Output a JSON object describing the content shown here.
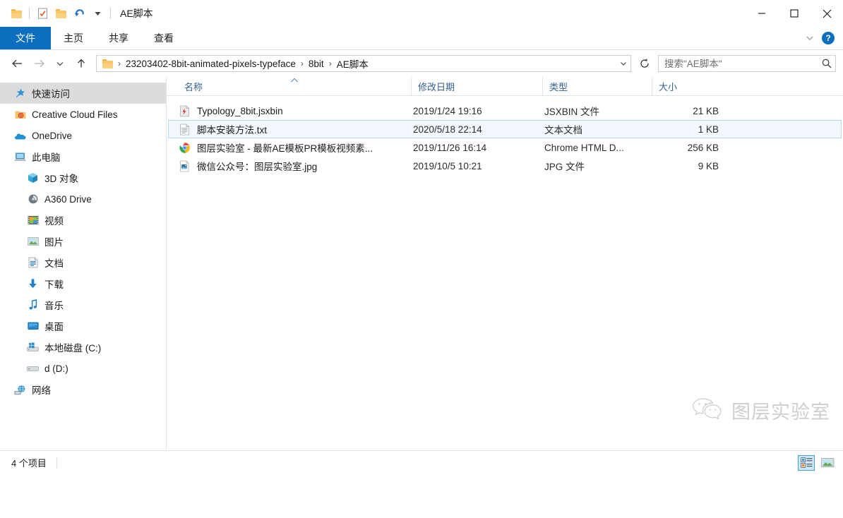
{
  "window": {
    "title": "AE脚本",
    "quick_access": [
      {
        "name": "folder-icon",
        "label": "folder"
      },
      {
        "name": "properties-icon",
        "label": "属性"
      },
      {
        "name": "new-folder-icon",
        "label": "新建文件夹"
      },
      {
        "name": "undo-icon",
        "label": "撤消"
      },
      {
        "name": "customize-qat-icon",
        "label": "自定义快速访问工具栏"
      }
    ],
    "controls": {
      "minimize": "—",
      "maximize": "□",
      "close": "✕"
    }
  },
  "ribbon": {
    "tabs": [
      {
        "label": "文件",
        "active": true
      },
      {
        "label": "主页",
        "active": false
      },
      {
        "label": "共享",
        "active": false
      },
      {
        "label": "查看",
        "active": false
      }
    ],
    "expand_icon": "chevron-down-icon",
    "help_label": "?"
  },
  "address": {
    "back_icon": "arrow-left-icon",
    "forward_icon": "arrow-right-icon",
    "recent_icon": "chevron-down-icon",
    "up_icon": "arrow-up-icon",
    "folder_icon": "folder-icon",
    "crumbs": [
      "23203402-8bit-animated-pixels-typeface",
      "8bit",
      "AE脚本"
    ],
    "separator": "›",
    "dropdown_icon": "chevron-down-icon",
    "refresh_icon": "refresh-icon"
  },
  "search": {
    "placeholder": "搜索\"AE脚本\"",
    "value": "",
    "icon": "search-icon"
  },
  "sidebar": {
    "items": [
      {
        "label": "快速访问",
        "icon": "pin-star-icon",
        "selected": true,
        "indent": false
      },
      {
        "label": "Creative Cloud Files",
        "icon": "creative-cloud-folder-icon",
        "selected": false,
        "indent": false
      },
      {
        "label": "OneDrive",
        "icon": "onedrive-cloud-icon",
        "selected": false,
        "indent": false
      },
      {
        "label": "此电脑",
        "icon": "this-pc-icon",
        "selected": false,
        "indent": false
      },
      {
        "label": "3D 对象",
        "icon": "3d-objects-icon",
        "selected": false,
        "indent": true
      },
      {
        "label": "A360 Drive",
        "icon": "a360-drive-icon",
        "selected": false,
        "indent": true
      },
      {
        "label": "视频",
        "icon": "videos-icon",
        "selected": false,
        "indent": true
      },
      {
        "label": "图片",
        "icon": "pictures-icon",
        "selected": false,
        "indent": true
      },
      {
        "label": "文档",
        "icon": "documents-icon",
        "selected": false,
        "indent": true
      },
      {
        "label": "下载",
        "icon": "downloads-icon",
        "selected": false,
        "indent": true
      },
      {
        "label": "音乐",
        "icon": "music-icon",
        "selected": false,
        "indent": true
      },
      {
        "label": "桌面",
        "icon": "desktop-icon",
        "selected": false,
        "indent": true
      },
      {
        "label": "本地磁盘 (C:)",
        "icon": "windows-drive-icon",
        "selected": false,
        "indent": true
      },
      {
        "label": "d (D:)",
        "icon": "drive-icon",
        "selected": false,
        "indent": true
      },
      {
        "label": "网络",
        "icon": "network-icon",
        "selected": false,
        "indent": false
      }
    ]
  },
  "filelist": {
    "columns": [
      {
        "label": "名称",
        "sorted": "asc"
      },
      {
        "label": "修改日期",
        "sorted": ""
      },
      {
        "label": "类型",
        "sorted": ""
      },
      {
        "label": "大小",
        "sorted": ""
      }
    ],
    "sort_caret": "︿",
    "rows": [
      {
        "name": "Typology_8bit.jsxbin",
        "date": "2019/1/24 19:16",
        "type": "JSXBIN 文件",
        "size": "21 KB",
        "icon": "jsxbin-file-icon",
        "selected": false
      },
      {
        "name": "脚本安装方法.txt",
        "date": "2020/5/18 22:14",
        "type": "文本文档",
        "size": "1 KB",
        "icon": "text-file-icon",
        "selected": true
      },
      {
        "name": "图层实验室 - 最新AE模板PR模板视频素...",
        "date": "2019/11/26 16:14",
        "type": "Chrome HTML D...",
        "size": "256 KB",
        "icon": "chrome-file-icon",
        "selected": false
      },
      {
        "name": "微信公众号：图层实验室.jpg",
        "date": "2019/10/5 10:21",
        "type": "JPG 文件",
        "size": "9 KB",
        "icon": "jpg-file-icon",
        "selected": false
      }
    ]
  },
  "statusbar": {
    "item_count": "4 个项目",
    "views": [
      {
        "name": "details-view-button",
        "active": true
      },
      {
        "name": "large-icons-view-button",
        "active": false
      }
    ]
  },
  "watermark": {
    "text": "图层实验室",
    "icon": "wechat-icon"
  },
  "colors": {
    "accent": "#0b6ebe",
    "selection_fill": "#f2f8fd",
    "selection_border": "#b3dcf5",
    "header_text": "#33628f",
    "sidebar_selected": "#dcdcdc"
  }
}
